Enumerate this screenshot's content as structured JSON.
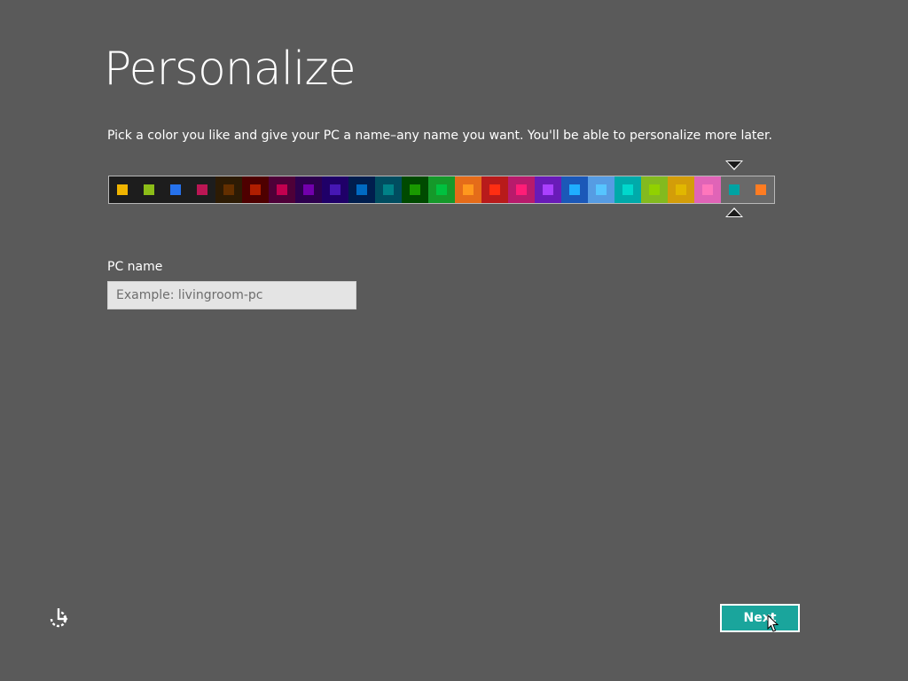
{
  "page": {
    "title": "Personalize",
    "subtitle": "Pick a color you like and give your PC a name–any name you want. You'll be able to personalize more later."
  },
  "color_picker": {
    "selected_index": 23,
    "swatches": [
      {
        "bg": "#1d1d1d",
        "chip": "#f0b400"
      },
      {
        "bg": "#1d1d1d",
        "chip": "#8cbd18"
      },
      {
        "bg": "#1d1d1d",
        "chip": "#2672ec"
      },
      {
        "bg": "#1d1d1d",
        "chip": "#bb1654"
      },
      {
        "bg": "#2d1b04",
        "chip": "#632f00"
      },
      {
        "bg": "#4e0000",
        "chip": "#b01e00"
      },
      {
        "bg": "#4e0038",
        "chip": "#c1004f"
      },
      {
        "bg": "#2d004e",
        "chip": "#7200ac"
      },
      {
        "bg": "#1f0068",
        "chip": "#4617b4"
      },
      {
        "bg": "#001e4e",
        "chip": "#006ac1"
      },
      {
        "bg": "#004d60",
        "chip": "#008287"
      },
      {
        "bg": "#004a00",
        "chip": "#199900"
      },
      {
        "bg": "#15992a",
        "chip": "#00c13f"
      },
      {
        "bg": "#e56c19",
        "chip": "#ff981d"
      },
      {
        "bg": "#b81b1b",
        "chip": "#ff2e12"
      },
      {
        "bg": "#b81b6c",
        "chip": "#ff1d77"
      },
      {
        "bg": "#691bb8",
        "chip": "#aa40ff"
      },
      {
        "bg": "#1b58b8",
        "chip": "#1faeff"
      },
      {
        "bg": "#569ce3",
        "chip": "#56c5ff"
      },
      {
        "bg": "#00aaaa",
        "chip": "#00d8cc"
      },
      {
        "bg": "#83ba1f",
        "chip": "#91d100"
      },
      {
        "bg": "#d39d09",
        "chip": "#e1b700"
      },
      {
        "bg": "#e064b7",
        "chip": "#ff76bc"
      },
      {
        "bg": "#696969",
        "chip": "#00a3a3"
      },
      {
        "bg": "#696969",
        "chip": "#fe7c22"
      }
    ]
  },
  "pc_name": {
    "label": "PC name",
    "placeholder": "Example: livingroom-pc",
    "value": ""
  },
  "footer": {
    "ease_of_access_icon": "ease-of-access-icon",
    "next_label": "Next"
  },
  "colors": {
    "background": "#5a5a5a",
    "accent": "#1aa59c",
    "input_bg": "#e4e4e4"
  }
}
